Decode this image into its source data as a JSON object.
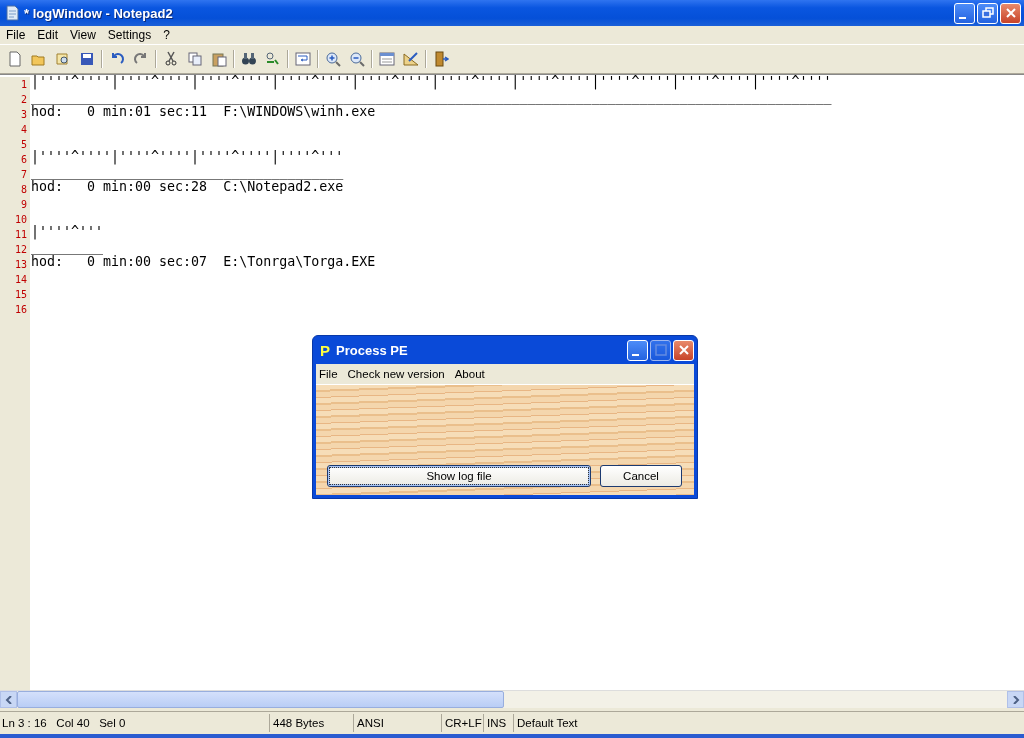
{
  "window": {
    "title": "* logWindow - Notepad2"
  },
  "menu": [
    "File",
    "Edit",
    "View",
    "Settings",
    "?"
  ],
  "editor": {
    "lines": [
      {
        "number": "1",
        "text": "|''''^''''|''''^''''|''''^''''|''''^''''|''''^''''|''''^''''|''''^''''|''''^''''|''''^''''|''''^''''"
      },
      {
        "number": "2",
        "text": "____________________________________________________________________________________________________"
      },
      {
        "number": "3",
        "text": "hod:   0 min:01 sec:11  F:\\WINDOWS\\winh.exe"
      },
      {
        "number": "4"
      },
      {
        "number": "5"
      },
      {
        "number": "6",
        "text": "|''''^''''|''''^''''|''''^''''|''''^'''"
      },
      {
        "number": "7",
        "text": "_______________________________________"
      },
      {
        "number": "8",
        "text": "hod:   0 min:00 sec:28  C:\\Notepad2.exe"
      },
      {
        "number": "9"
      },
      {
        "number": "10"
      },
      {
        "number": "11",
        "text": "|''''^'''"
      },
      {
        "number": "12",
        "text": "_________"
      },
      {
        "number": "13",
        "text": "hod:   0 min:00 sec:07  E:\\Tonrga\\Torga.EXE"
      },
      {
        "number": "14"
      },
      {
        "number": "15"
      },
      {
        "number": "16"
      }
    ]
  },
  "status_bar": [
    "Ln 3 : 16   Col 40   Sel 0",
    "448 Bytes",
    "ANSI",
    "CR+LF",
    "INS",
    "Default Text"
  ],
  "dialog": {
    "logo": "P",
    "title": "Process PE",
    "menu": [
      "File",
      "Check new version",
      "About"
    ],
    "buttons": [
      {
        "label": "Show log file",
        "focused": true
      },
      {
        "label": "Cancel",
        "focused": false
      }
    ]
  }
}
